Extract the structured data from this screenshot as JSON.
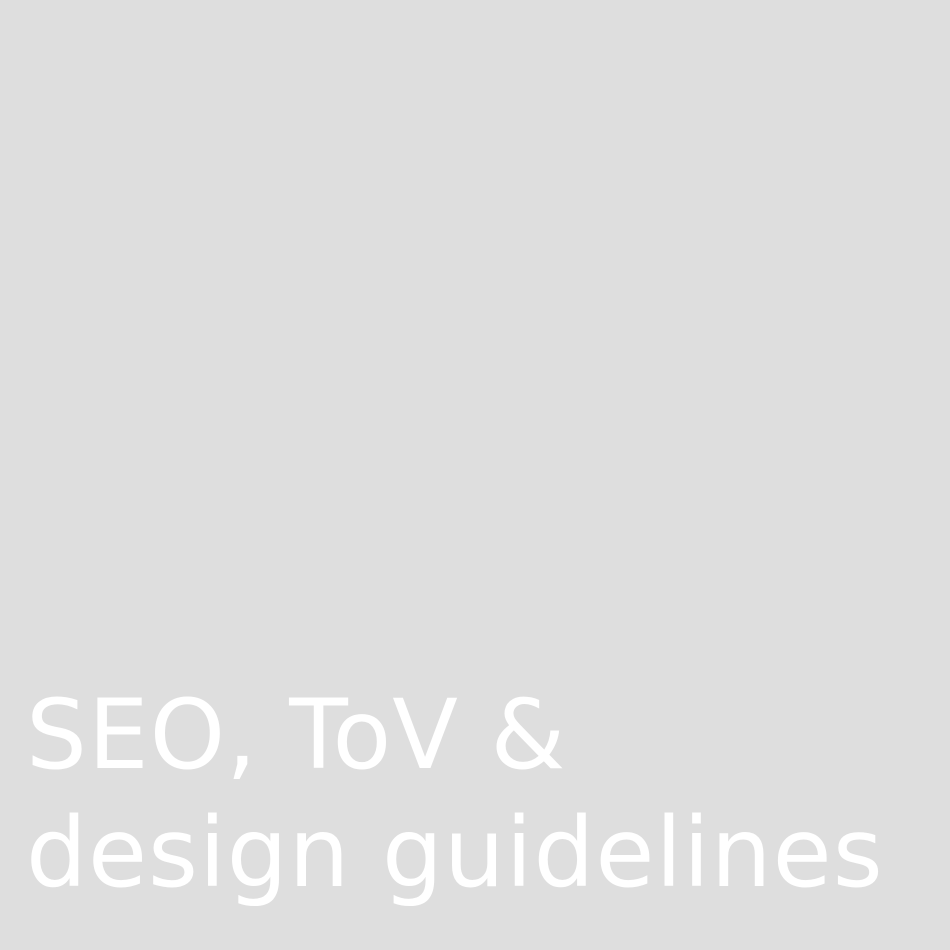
{
  "tile": {
    "background_color": "#dedede",
    "text_color": "#ffffff",
    "title_lines": [
      "SEO, ToV &",
      "design guidelines"
    ]
  }
}
